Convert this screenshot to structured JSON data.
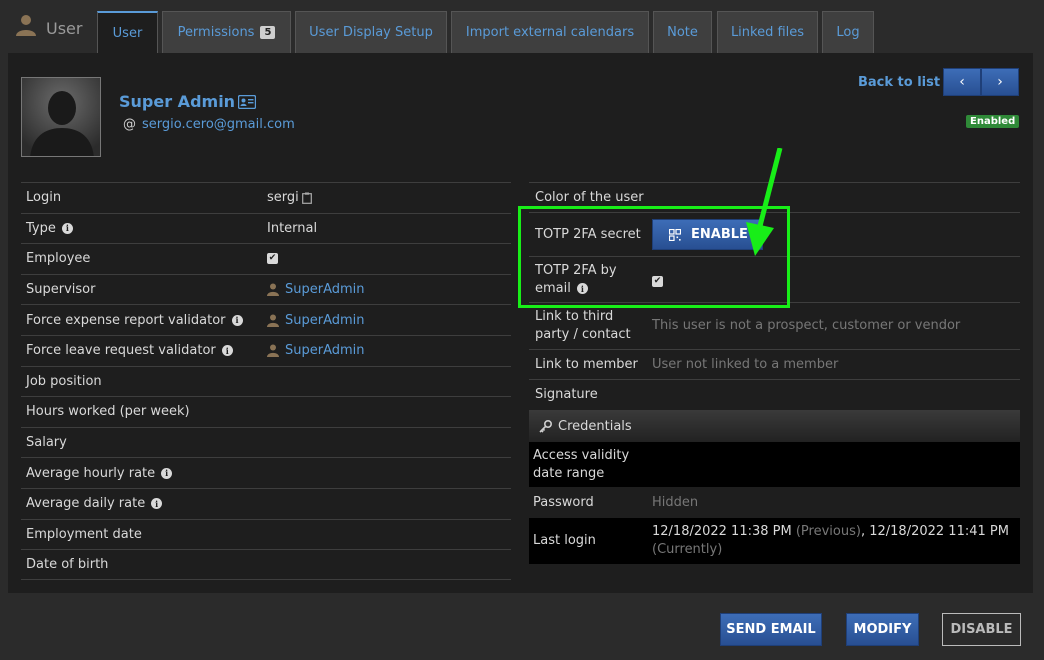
{
  "header": {
    "page_label": "User",
    "tabs": [
      {
        "label": "User",
        "active": true
      },
      {
        "label": "Permissions",
        "badge": "5"
      },
      {
        "label": "User Display Setup"
      },
      {
        "label": "Import external calendars"
      },
      {
        "label": "Note"
      },
      {
        "label": "Linked files"
      },
      {
        "label": "Log"
      }
    ]
  },
  "profile": {
    "name": "Super Admin",
    "email": "sergio.cero@gmail.com",
    "at": "@",
    "back_to_list": "Back to list",
    "prev_icon": "‹",
    "next_icon": "›",
    "status": "Enabled"
  },
  "left_fields": {
    "login": {
      "label": "Login",
      "value": "sergi"
    },
    "type": {
      "label": "Type",
      "value": "Internal"
    },
    "employee": {
      "label": "Employee",
      "checked": true
    },
    "supervisor": {
      "label": "Supervisor",
      "value": "SuperAdmin"
    },
    "expense_validator": {
      "label": "Force expense report validator",
      "value": "SuperAdmin"
    },
    "leave_validator": {
      "label": "Force leave request validator",
      "value": "SuperAdmin"
    },
    "job_position": {
      "label": "Job position"
    },
    "hours_worked": {
      "label": "Hours worked (per week)"
    },
    "salary": {
      "label": "Salary"
    },
    "avg_hourly": {
      "label": "Average hourly rate"
    },
    "avg_daily": {
      "label": "Average daily rate"
    },
    "employment_date": {
      "label": "Employment date"
    },
    "dob": {
      "label": "Date of birth"
    }
  },
  "right_fields": {
    "color": {
      "label": "Color of the user"
    },
    "totp_secret": {
      "label": "TOTP 2FA secret",
      "button": "ENABLE"
    },
    "totp_email": {
      "label_line1": "TOTP 2FA by",
      "label_line2": "email",
      "checked": true
    },
    "third_party": {
      "label_line1": "Link to third",
      "label_line2": "party / contact",
      "value": "This user is not a prospect, customer or vendor"
    },
    "member": {
      "label": "Link to member",
      "value": "User not linked to a member"
    },
    "signature": {
      "label": "Signature"
    },
    "credentials_header": "Credentials",
    "validity": {
      "label_line1": "Access validity",
      "label_line2": "date range"
    },
    "password": {
      "label": "Password",
      "value": "Hidden"
    },
    "last_login": {
      "label": "Last login",
      "previous_time": "12/18/2022 11:38 PM",
      "previous_tag": "(Previous)",
      "separator": ",",
      "current_time": "12/18/2022 11:41 PM",
      "current_tag": "(Currently)"
    }
  },
  "actions": {
    "send_email": "SEND EMAIL",
    "modify": "MODIFY",
    "disable": "DISABLE"
  }
}
